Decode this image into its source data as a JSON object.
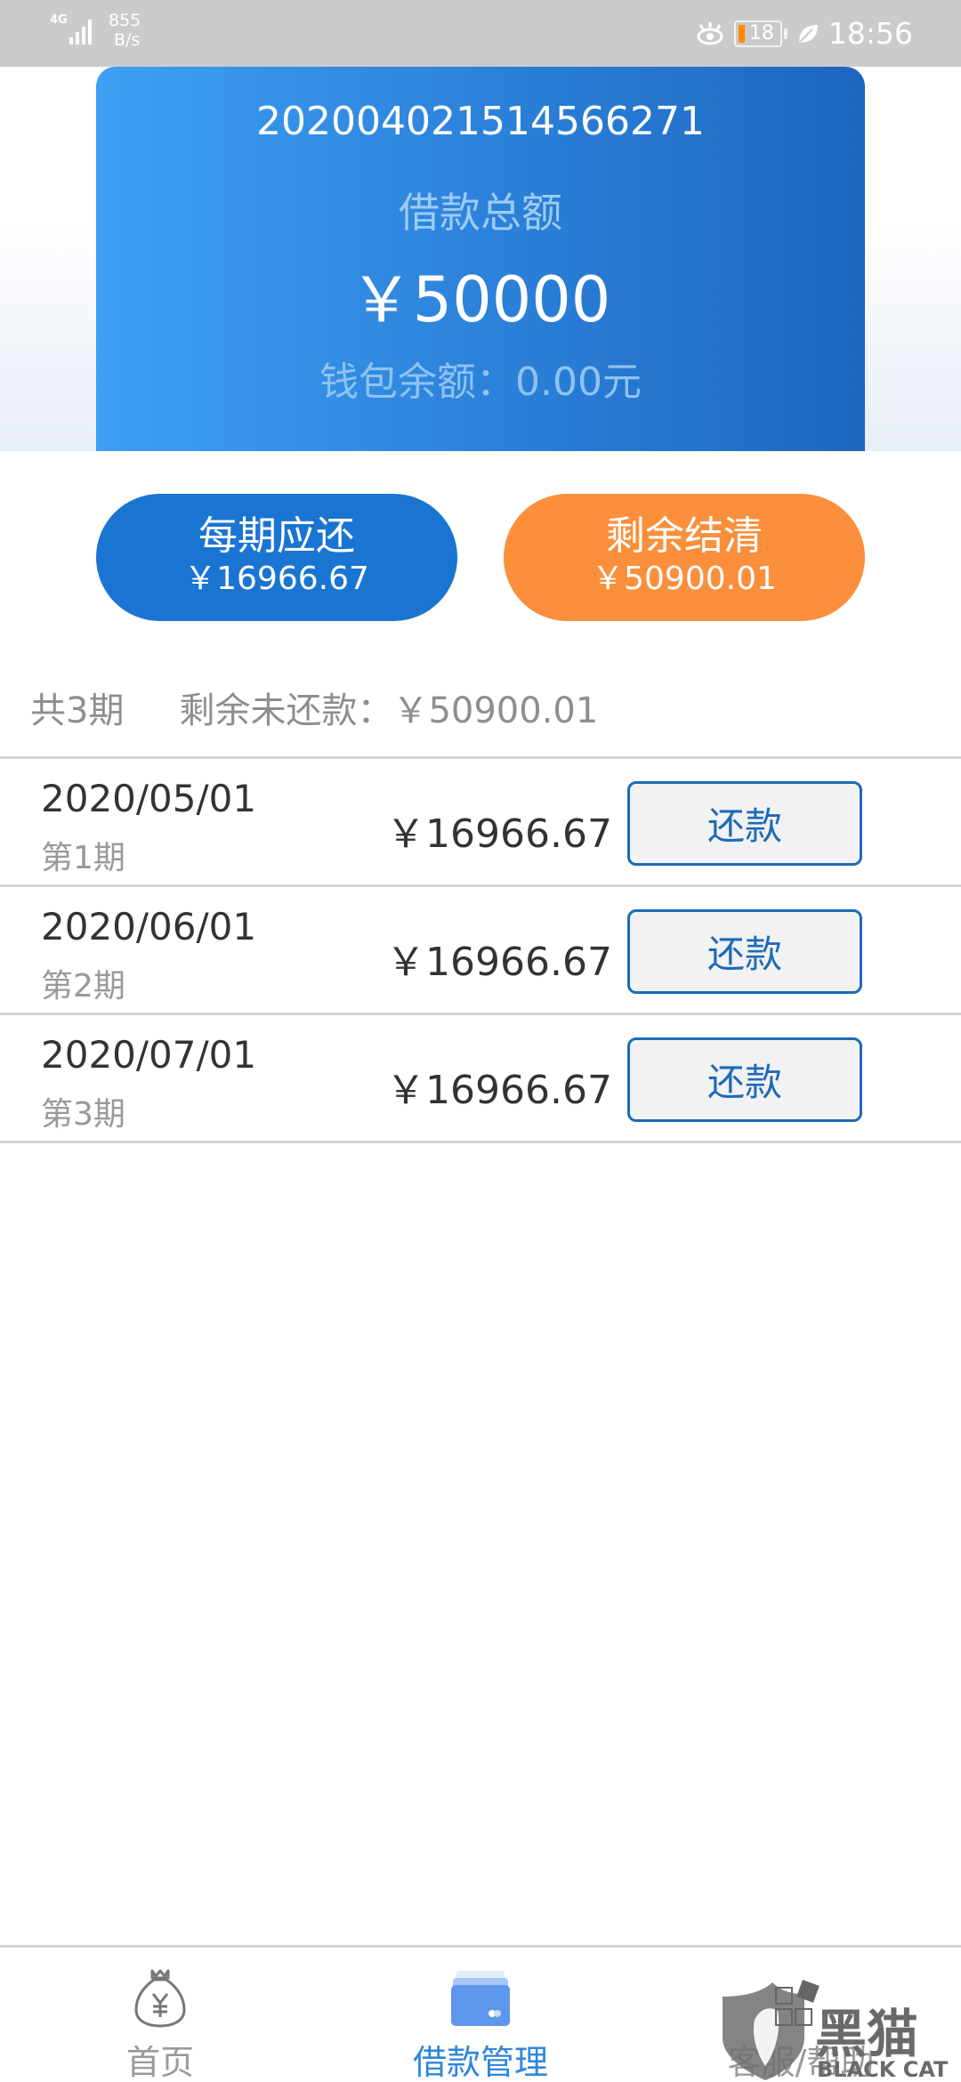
{
  "status_bar": {
    "network": "4G",
    "net_speed_value": "855",
    "net_speed_unit": "B/s",
    "battery_level": "18",
    "time": "18:56"
  },
  "loan_card": {
    "order_number": "202004021514566271",
    "total_label": "借款总额",
    "total_amount": "￥50000",
    "wallet_balance": "钱包余额：0.00元"
  },
  "actions": {
    "installment": {
      "title": "每期应还",
      "amount": "￥16966.67"
    },
    "payoff": {
      "title": "剩余结清",
      "amount": "￥50900.01"
    }
  },
  "summary": {
    "total_periods": "共3期",
    "remaining_unpaid": "剩余未还款：￥50900.01"
  },
  "installments": [
    {
      "date": "2020/05/01",
      "period": "第1期",
      "amount": "￥16966.67",
      "button": "还款"
    },
    {
      "date": "2020/06/01",
      "period": "第2期",
      "amount": "￥16966.67",
      "button": "还款"
    },
    {
      "date": "2020/07/01",
      "period": "第3期",
      "amount": "￥16966.67",
      "button": "还款"
    }
  ],
  "bottom_nav": {
    "items": [
      {
        "label": "首页",
        "icon": "money-bag-icon",
        "active": false
      },
      {
        "label": "借款管理",
        "icon": "card-wallet-icon",
        "active": true
      },
      {
        "label": "客服/帮助",
        "icon": "help-icon",
        "active": false
      }
    ]
  },
  "watermark": {
    "text_cn": "黑猫",
    "text_en": "BLACK CAT"
  },
  "colors": {
    "primary_blue": "#1a74d2",
    "accent_orange": "#fb8f3c",
    "repay_button_border": "#1c6bb8",
    "nav_active": "#2f86de"
  }
}
